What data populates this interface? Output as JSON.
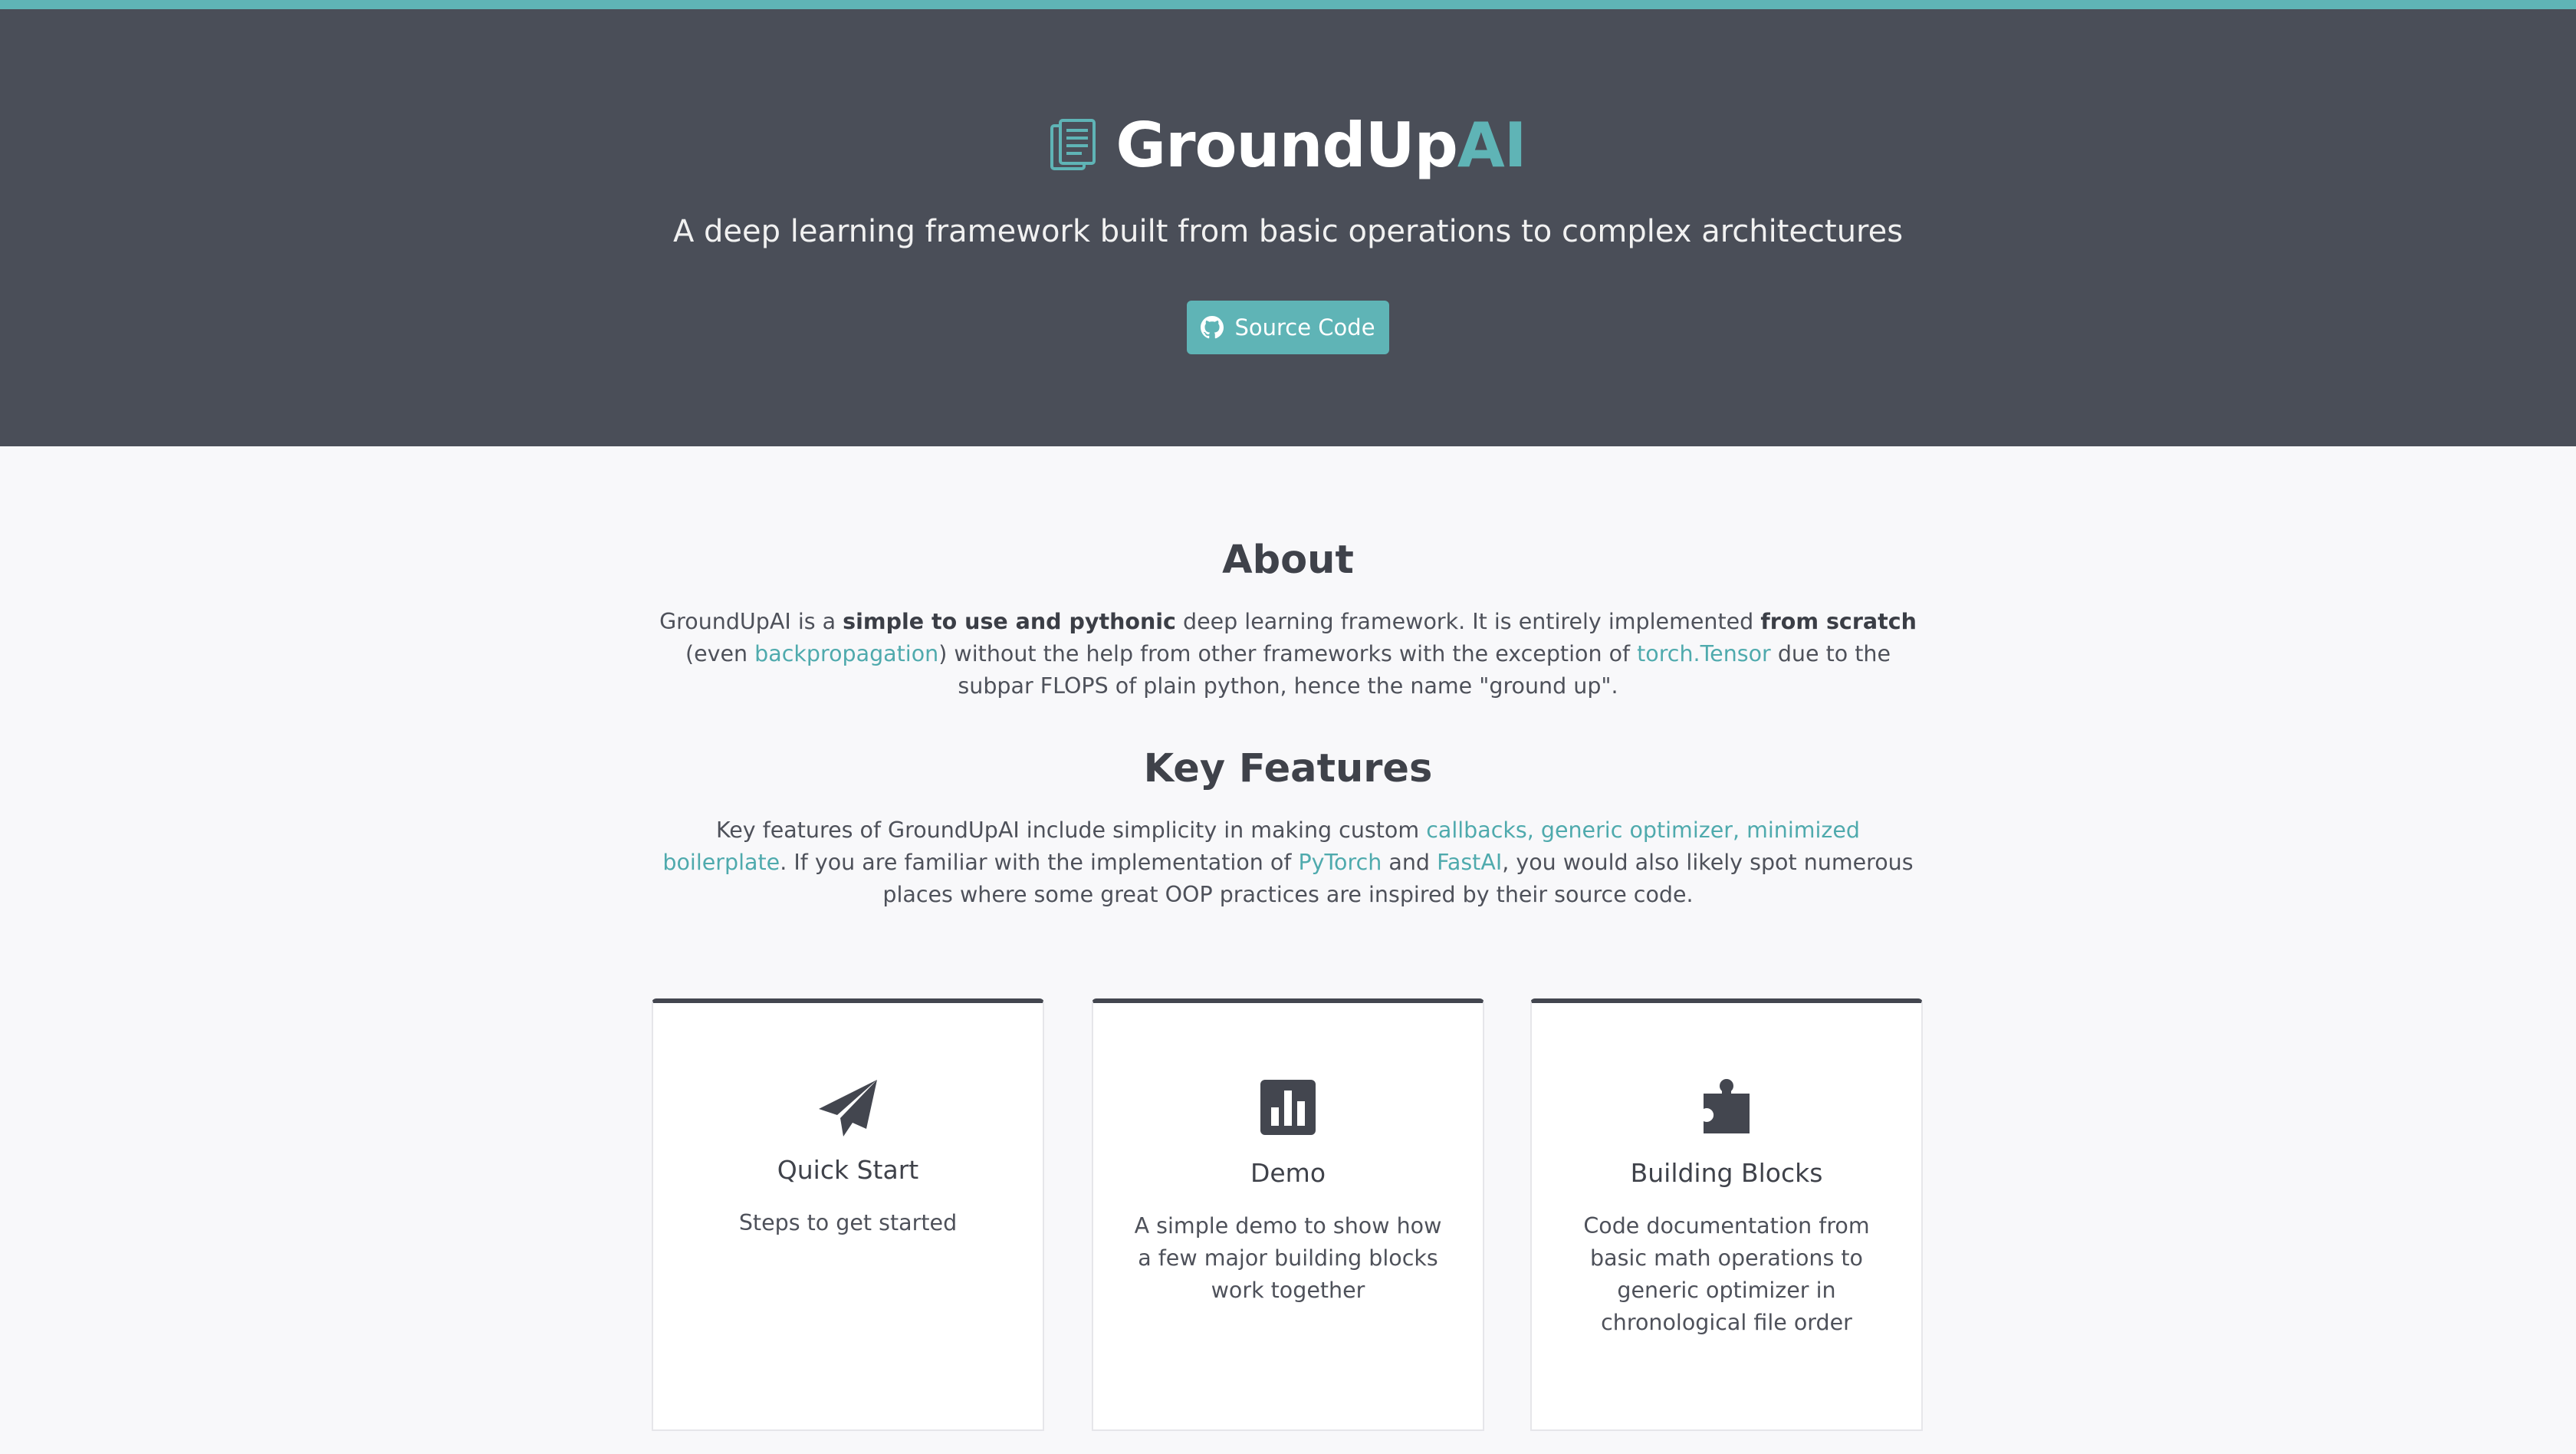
{
  "header": {
    "brand_main": "GroundUp",
    "brand_accent": "AI",
    "tagline": "A deep learning framework built from basic operations to complex architectures",
    "source_button_label": "Source Code",
    "icons": {
      "logo": "document-icon",
      "source": "github-icon"
    }
  },
  "about": {
    "title": "About",
    "p1": "GroundUpAI is a ",
    "bold1": "simple to use and pythonic",
    "p2": " deep learning framework. It is entirely implemented ",
    "bold2": "from scratch",
    "p3": " (even ",
    "link1": "backpropagation",
    "p4": ") without the help from other frameworks with the exception of ",
    "link2": "torch.Tensor",
    "p5": " due to the subpar FLOPS of plain python, hence the name \"ground up\"."
  },
  "features": {
    "title": "Key Features",
    "p1": "Key features of GroundUpAI include simplicity in making custom ",
    "link1": "callbacks, generic optimizer, minimized boilerplate",
    "p2": ". If you are familiar with the implementation of ",
    "link2": "PyTorch",
    "p3": " and ",
    "link3": "FastAI",
    "p4": ", you would also likely spot numerous places where some great OOP practices are inspired by their source code."
  },
  "cards": [
    {
      "title": "Quick Start",
      "desc": "Steps to get started",
      "icon": "paper-plane-icon"
    },
    {
      "title": "Demo",
      "desc": "A simple demo to show how a few major building blocks work together",
      "icon": "bar-chart-icon"
    },
    {
      "title": "Building Blocks",
      "desc": "Code documentation from basic math operations to generic optimizer in chronological file order",
      "icon": "puzzle-piece-icon"
    }
  ],
  "colors": {
    "accent": "#5fb4b6",
    "hero_bg": "#4a4e58",
    "page_bg": "#f8f8fa",
    "card_border_top": "#43464f"
  }
}
